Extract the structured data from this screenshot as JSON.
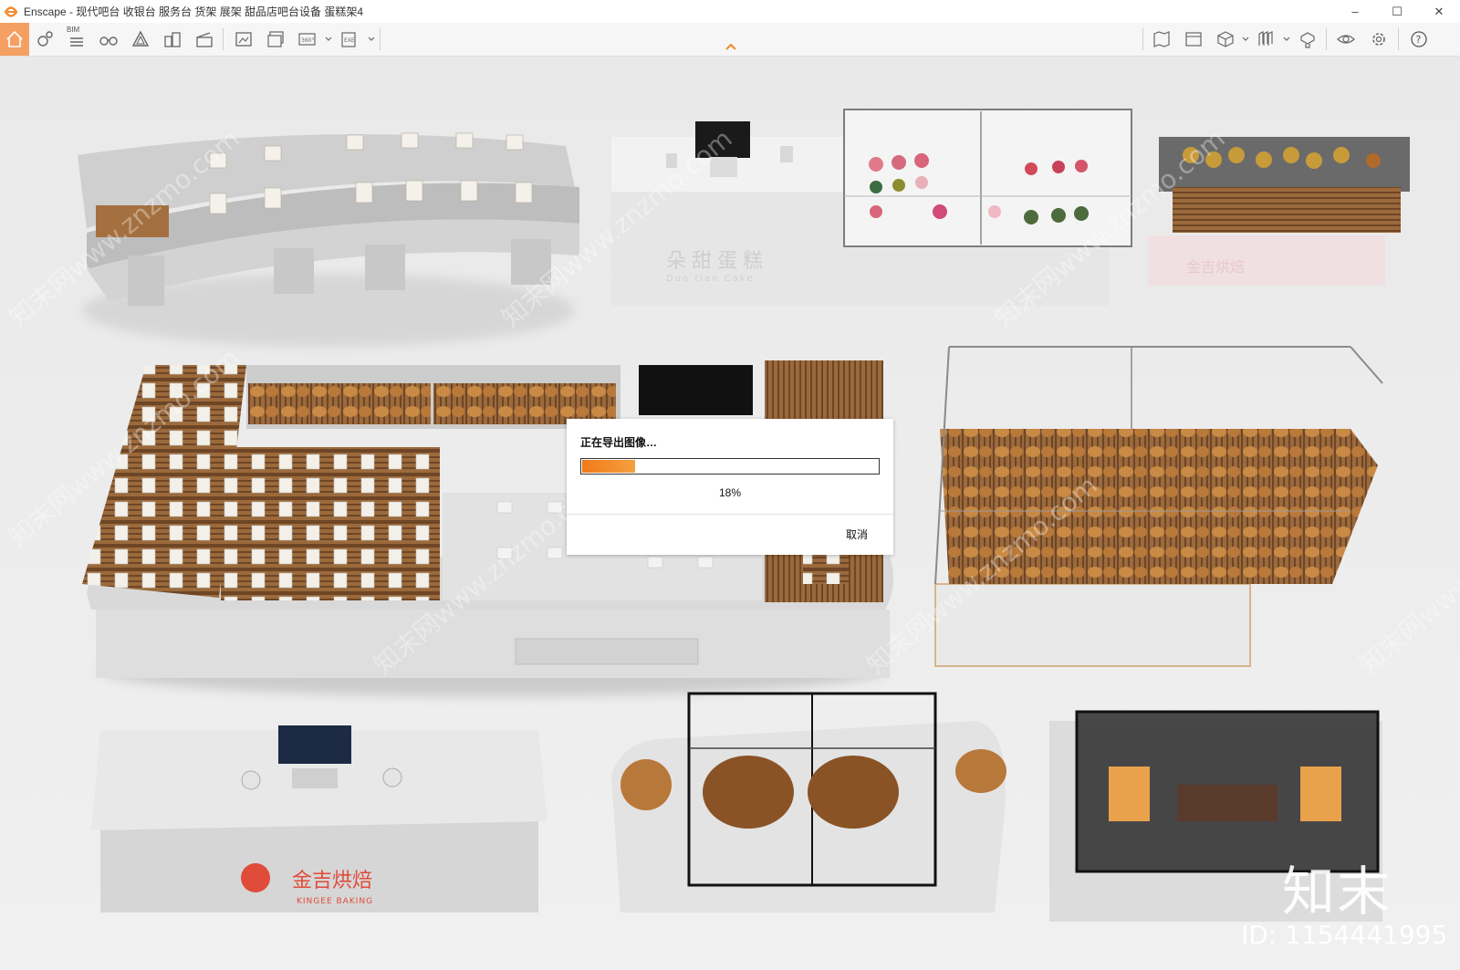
{
  "window": {
    "title": "Enscape - 现代吧台 收银台 服务台 货架 展架 甜品店吧台设备 蛋糕架4",
    "controls": {
      "minimize": "–",
      "maximize": "☐",
      "close": "✕"
    }
  },
  "toolbar": {
    "bim_label": "BIM",
    "left_icons": [
      "home-icon",
      "location-icon",
      "bim-list-icon",
      "binoculars-icon",
      "triangle-icon",
      "buildings-icon",
      "clapper-icon",
      "screenshot-icon",
      "batch-render-icon",
      "panorama-360-icon",
      "exe-export-icon"
    ],
    "right_icons": [
      "map-icon",
      "views-icon",
      "cube-icon",
      "asset-library-icon",
      "material-icon",
      "visual-settings-icon",
      "settings-icon",
      "help-icon"
    ],
    "accent_color": "#f5a063"
  },
  "export_dialog": {
    "title": "正在导出图像…",
    "progress": 0.18,
    "progress_text": "18%",
    "cancel_label": "取消",
    "bar_color": "#f07a1a"
  },
  "scene": {
    "cashier_brand_cn": "金吉烘焙",
    "cashier_brand_en": "KINGEE BAKING",
    "counter_sign_cn": "朵甜蛋糕",
    "counter_sign_en": "Duo tian Cake",
    "display_brand": "金吉烘焙"
  },
  "watermark": {
    "logo": "知末",
    "id_text": "ID: 1154441995",
    "diagonal_text": "知末网www.znzmo.com"
  }
}
